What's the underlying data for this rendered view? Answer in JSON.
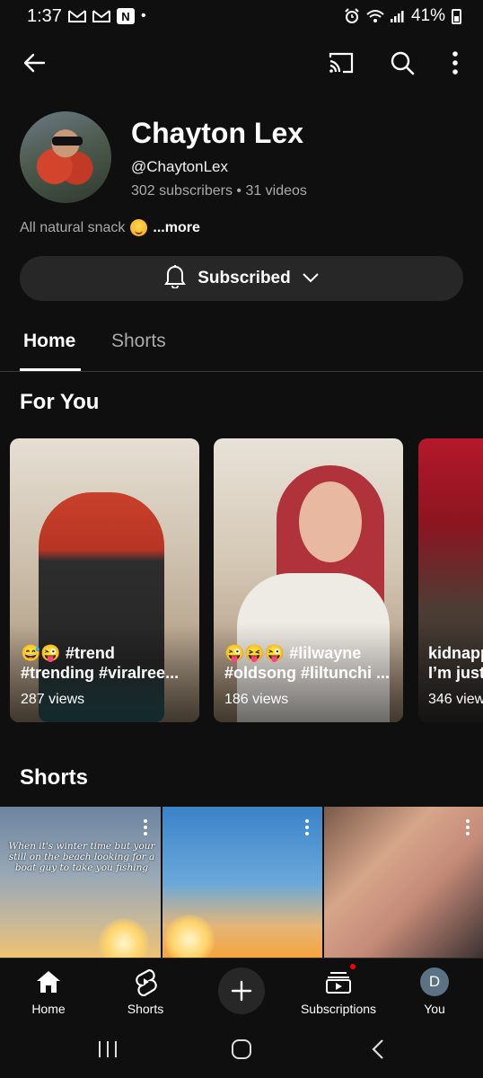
{
  "status_bar": {
    "time": "1:37",
    "battery": "41%",
    "icons": [
      "gmail-icon",
      "gmail-icon",
      "app-notification-icon",
      "dot-icon",
      "alarm-icon",
      "wifi-icon",
      "signal-icon",
      "battery-icon"
    ]
  },
  "app_bar": {
    "icons": [
      "back-arrow-icon",
      "cast-icon",
      "search-icon",
      "more-vert-icon"
    ]
  },
  "channel": {
    "name": "Chayton Lex",
    "handle": "@ChaytonLex",
    "stats": "302 subscribers • 31 videos",
    "description": "All natural snack",
    "more_label": "...more",
    "subscribe_label": "Subscribed"
  },
  "tabs": [
    {
      "label": "Home",
      "active": true
    },
    {
      "label": "Shorts",
      "active": false
    }
  ],
  "sections": {
    "for_you_title": "For You",
    "shorts_title": "Shorts"
  },
  "for_you": [
    {
      "line1": "😅😜 #trend",
      "line2": "#trending  #viralree...",
      "views": "287 views"
    },
    {
      "line1": "😜😝😜 #lilwayne",
      "line2": "#oldsong #liltunchi ...",
      "views": "186 views"
    },
    {
      "line1": "kidnapp",
      "line2": "I’m just",
      "views": "346 view"
    }
  ],
  "shorts": [
    {
      "caption": "When it's winter time but your still on the beach looking for a boat guy to take you fishing"
    },
    {
      "caption": ""
    },
    {
      "caption": ""
    }
  ],
  "bottom_nav": [
    {
      "label": "Home",
      "icon": "home-icon"
    },
    {
      "label": "Shorts",
      "icon": "shorts-icon"
    },
    {
      "label": "",
      "icon": "create-plus-icon"
    },
    {
      "label": "Subscriptions",
      "icon": "subscriptions-icon"
    },
    {
      "label": "You",
      "icon": "profile-avatar",
      "avatar_letter": "D"
    }
  ],
  "colors": {
    "background": "#0f0f0f",
    "surface": "#272727",
    "secondary_text": "#aaaaaa",
    "notification": "#ff0000"
  }
}
